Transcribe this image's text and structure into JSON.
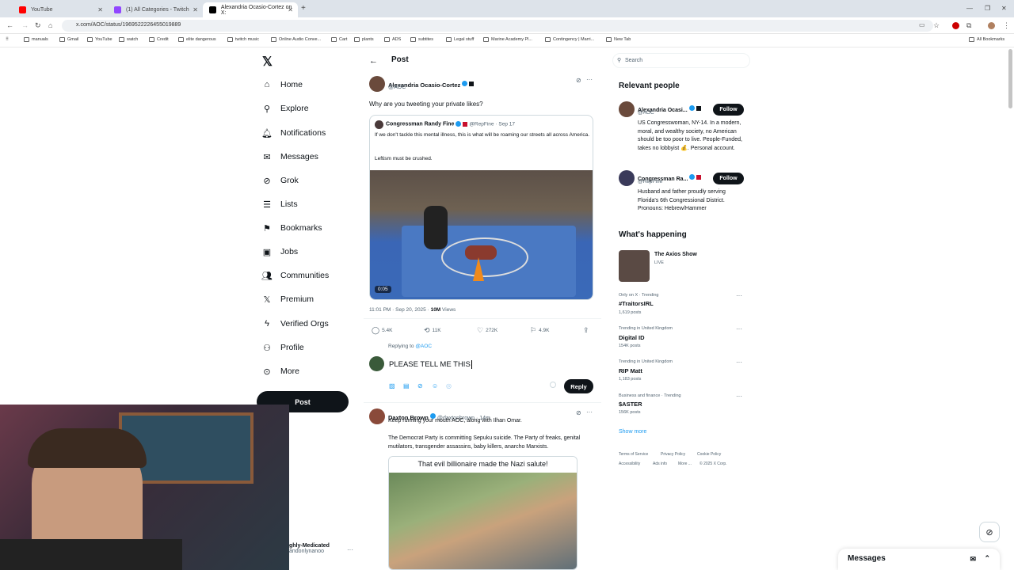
{
  "browser": {
    "tabs": [
      {
        "label": "YouTube",
        "color": "#ff0000"
      },
      {
        "label": "(1) All Categories - Twitch",
        "color": "#9146ff"
      },
      {
        "label": "Alexandria Ocasio-Cortez on X:",
        "color": "#000000"
      }
    ],
    "url": "x.com/AOC/status/1969522226455019889",
    "bookmarks": [
      "manuals",
      "Gmail",
      "YouTube",
      "watch",
      "Credit",
      "elite dangerous",
      "twitch music",
      "Online Audio Conve...",
      "Cart",
      "plants",
      "ADS",
      "subtites",
      "Legal stuff",
      "Marine Academy Pl...",
      "Contingency | Marri...",
      "New Tab"
    ],
    "all_bookmarks": "All Bookmarks"
  },
  "nav": {
    "items": [
      "Home",
      "Explore",
      "Notifications",
      "Messages",
      "Grok",
      "Lists",
      "Bookmarks",
      "Jobs",
      "Communities",
      "Premium",
      "Verified Orgs",
      "Profile",
      "More"
    ],
    "post_label": "Post",
    "user_name": "ghly-Medicated",
    "user_handle": "andonlynanoo"
  },
  "post": {
    "header": "Post",
    "author": "Alexandria Ocasio-Cortez",
    "handle": "@AOC",
    "text": "Why are you tweeting your private likes?",
    "quote": {
      "author": "Congressman Randy Fine",
      "handle": "@RepFine",
      "date": "· Sep 17",
      "line1": "If we don't tackle this mental illness, this is what will be roaming our streets all across America.",
      "line2": "Leftism must be crushed.",
      "duration": "0:05"
    },
    "timestamp": "11:01 PM · Sep 20, 2025 · ",
    "views_num": "10M",
    "views_label": " Views",
    "stats": {
      "replies": "5.4K",
      "reposts": "11K",
      "likes": "272K",
      "bookmarks": "4.9K"
    }
  },
  "reply_box": {
    "replying_prefix": "Replying to ",
    "replying_to": "@AOC",
    "draft": "PLEASE TELL ME THIS",
    "reply_label": "Reply"
  },
  "reply": {
    "author": "Daxton Brown",
    "handle": "@daxtonbrown · 14m",
    "line1": "Keep running your mouth AOC, along with Ilhan Omar.",
    "line2": "The Democrat Party is committing Sepuku suicide. The Party of freaks, genital mutilators, transgender assassins, baby killers, anarcho Marxists.",
    "meme_caption": "That evil billionaire made the Nazi salute!"
  },
  "right": {
    "search_placeholder": "Search",
    "relevant_title": "Relevant people",
    "people": [
      {
        "name": "Alexandria Ocasi...",
        "handle": "@AOC",
        "bio": "US Congresswoman, NY-14. In a modern, moral, and wealthy society, no American should be too poor to live. People-Funded, takes no lobbyist 💰. Personal account.",
        "follow": "Follow"
      },
      {
        "name": "Congressman Ra...",
        "handle": "@RepFine",
        "bio": "Husband and father proudly serving Florida's 6th Congressional District. Pronouns: Hebrew/Hammer",
        "follow": "Follow"
      }
    ],
    "happening_title": "What's happening",
    "live_show": {
      "name": "The Axios Show",
      "status": "LIVE"
    },
    "trends": [
      {
        "meta": "Only on X · Trending",
        "name": "#TraitorsIRL",
        "count": "1,619 posts"
      },
      {
        "meta": "Trending in United Kingdom",
        "name": "Digital ID",
        "count": "154K posts"
      },
      {
        "meta": "Trending in United Kingdom",
        "name": "RIP Matt",
        "count": "1,183 posts"
      },
      {
        "meta": "Business and finance · Trending",
        "name": "$ASTER",
        "count": "156K posts"
      }
    ],
    "show_more": "Show more",
    "footer1": [
      "Terms of Service",
      "Privacy Policy",
      "Cookie Policy"
    ],
    "footer2": [
      "Accessibility",
      "Ads info",
      "More ...",
      "© 2025 X Corp."
    ],
    "messages": "Messages"
  }
}
